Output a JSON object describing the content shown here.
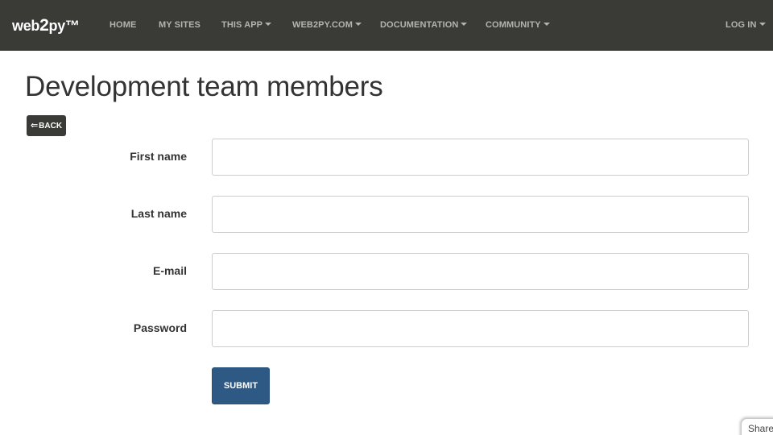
{
  "navbar": {
    "brand": {
      "pre": "web",
      "two": "2",
      "post": "py™"
    },
    "items": [
      {
        "label": "HOME",
        "dropdown": false
      },
      {
        "label": "MY SITES",
        "dropdown": false
      },
      {
        "label": "THIS APP",
        "dropdown": true
      },
      {
        "label": "WEB2PY.COM",
        "dropdown": true
      },
      {
        "label": "DOCUMENTATION",
        "dropdown": true
      },
      {
        "label": "COMMUNITY",
        "dropdown": true
      }
    ],
    "login": {
      "label": "LOG IN",
      "dropdown": true
    }
  },
  "page": {
    "title": "Development team members",
    "back_label": "BACK"
  },
  "form": {
    "fields": [
      {
        "label": "First name",
        "value": "",
        "type": "text"
      },
      {
        "label": "Last name",
        "value": "",
        "type": "text"
      },
      {
        "label": "E-mail",
        "value": "",
        "type": "email"
      },
      {
        "label": "Password",
        "value": "",
        "type": "password"
      }
    ],
    "submit_label": "SUBMIT"
  },
  "share": {
    "label": "Share"
  },
  "colors": {
    "navbar_bg": "#3a3a36",
    "nav_text": "#b4b4ae",
    "submit_bg": "#2f5985",
    "back_bg": "#3a3a36"
  }
}
